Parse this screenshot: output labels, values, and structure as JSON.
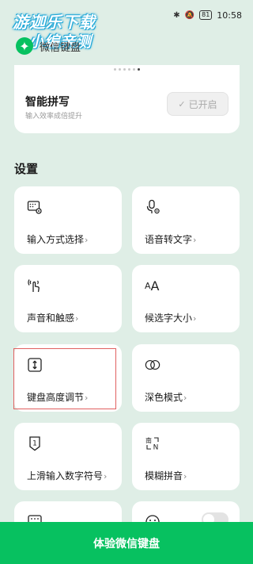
{
  "status_bar": {
    "time": "10:58",
    "battery": "81",
    "icons": [
      "bluetooth-icon",
      "mute-icon"
    ]
  },
  "watermark": {
    "line1": "游迦乐下载",
    "line2": "小编亲测"
  },
  "header": {
    "title": "微信键盘",
    "logo_icon": "wechat-keyboard-logo"
  },
  "smart_pinyin": {
    "title": "智能拼写",
    "subtitle": "输入效率成倍提升",
    "button_label": "已开启",
    "page_dots": 6,
    "active_dot": 5
  },
  "settings": {
    "section_title": "设置",
    "items": [
      {
        "label": "输入方式选择",
        "icon": "keyboard-gear-icon"
      },
      {
        "label": "语音转文字",
        "icon": "mic-gear-icon"
      },
      {
        "label": "声音和触感",
        "icon": "tap-vibration-icon"
      },
      {
        "label": "候选字大小",
        "icon": "font-size-icon"
      },
      {
        "label": "键盘高度调节",
        "icon": "height-adjust-icon"
      },
      {
        "label": "深色模式",
        "icon": "dark-mode-icon"
      },
      {
        "label": "上滑输入数字符号",
        "icon": "swipe-number-icon"
      },
      {
        "label": "模糊拼音",
        "icon": "fuzzy-pinyin-icon"
      }
    ],
    "chevron": "›"
  },
  "bottom_button": {
    "label": "体验微信键盘"
  },
  "colors": {
    "brand_green": "#07c160",
    "background": "#dfeee6",
    "highlight": "#e06060"
  }
}
